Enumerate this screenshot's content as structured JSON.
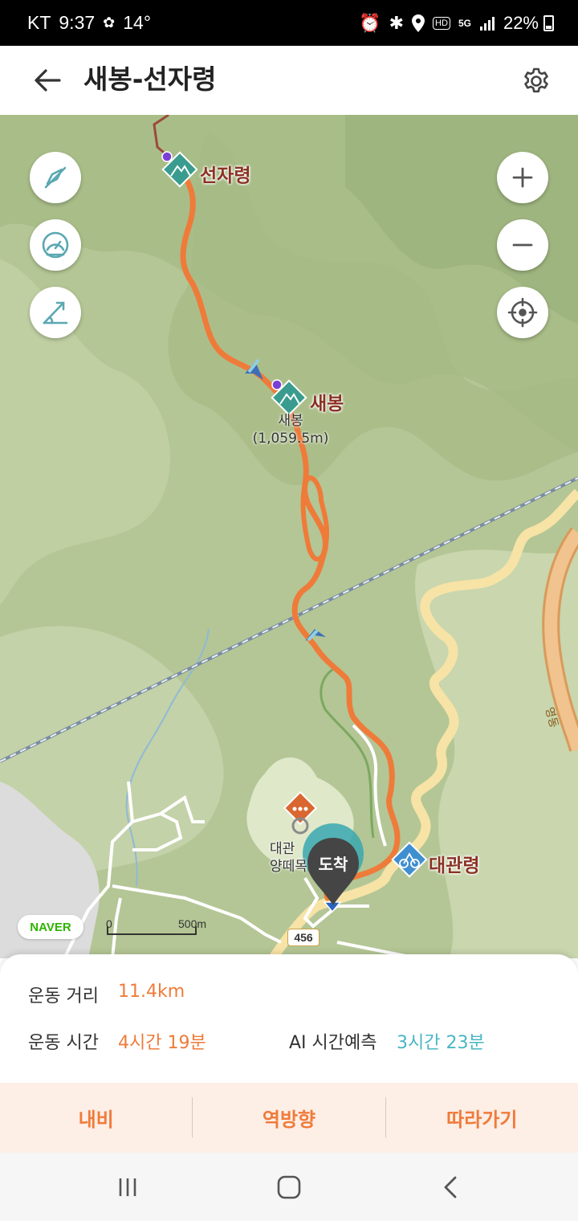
{
  "status_bar": {
    "carrier": "KT",
    "time": "9:37",
    "temperature": "14°",
    "network_badge": "HD",
    "network_type": "5G",
    "battery": "22%"
  },
  "header": {
    "title": "새봉-선자령"
  },
  "map": {
    "peak_seonjaryeong": "선자령",
    "peak_saebong": "새봉",
    "saebong_sub_name": "새봉",
    "saebong_elevation": "(1,059.5m)",
    "pass_daegwallyeong": "대관령",
    "ranch_line1": "대관",
    "ranch_line2": "양떼목",
    "arrival_label": "도착",
    "scale_zero": "0",
    "scale_distance": "500m",
    "road_number": "456",
    "road_side_text": "영동",
    "logo": "NAVER",
    "route_color": "#ef7b3a"
  },
  "stats": {
    "distance_label": "운동 거리",
    "distance_value": "11.4km",
    "time_label": "운동 시간",
    "time_value": "4시간 19분",
    "ai_label": "AI 시간예측",
    "ai_value": "3시간 23분"
  },
  "actions": {
    "navi": "내비",
    "reverse": "역방향",
    "follow": "따라가기"
  },
  "icons": {
    "back": "arrow-left-icon",
    "settings": "gear-icon",
    "zoom_in": "plus-icon",
    "zoom_out": "minus-icon",
    "locate": "crosshair-icon"
  }
}
